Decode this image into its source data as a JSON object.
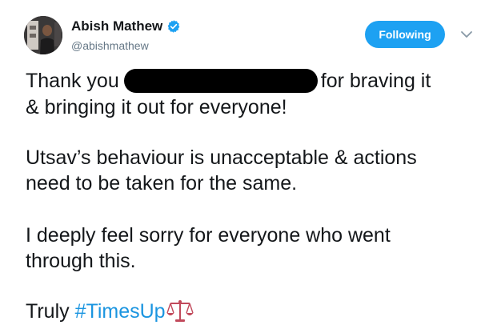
{
  "header": {
    "display_name": "Abish Mathew",
    "handle": "@abishmathew",
    "follow_label": "Following",
    "verified_icon": "verified-badge-icon",
    "menu_icon": "chevron-down-icon"
  },
  "tweet": {
    "line1_start": "Thank you",
    "line1_end": "for braving it",
    "line2": "& bringing it out for everyone!",
    "line3": "Utsav’s behaviour is unacceptable & actions",
    "line4": "need to be taken for the same.",
    "line5": "I deeply feel sorry for everyone who went",
    "line6": "through this.",
    "line7_prefix": "Truly",
    "hashtag": "#TimesUp",
    "emoji_icon": "balance-scale-icon"
  },
  "colors": {
    "follow_button": "#1da1f2",
    "hashtag": "#1b95e0",
    "handle": "#657786",
    "text": "#14171a",
    "emoji": "#c1495b"
  }
}
